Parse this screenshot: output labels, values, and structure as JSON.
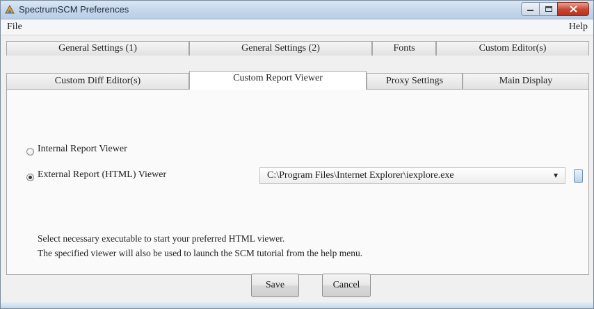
{
  "window": {
    "title": "SpectrumSCM Preferences",
    "icon": "spectrum-app-icon",
    "controls": [
      "minimize-icon",
      "maximize-icon",
      "close-icon"
    ]
  },
  "menu": {
    "file": "File",
    "help": "Help"
  },
  "tabs": {
    "row_back": [
      {
        "label": "General Settings (1)"
      },
      {
        "label": "General Settings (2)"
      },
      {
        "label": "Fonts"
      },
      {
        "label": "Custom Editor(s)"
      }
    ],
    "row_front": [
      {
        "label": "Custom Diff Editor(s)"
      },
      {
        "label": "Custom Report Viewer"
      },
      {
        "label": "Proxy Settings"
      },
      {
        "label": "Main Display"
      }
    ],
    "active": "Custom Report Viewer"
  },
  "options": {
    "internal_label": "Internal Report Viewer",
    "external_label": "External Report (HTML) Viewer",
    "selected": "external"
  },
  "viewer_path": {
    "value": "C:\\Program Files\\Internet Explorer\\iexplore.exe"
  },
  "info": {
    "line1": "Select necessary executable to start your preferred HTML viewer.",
    "line2": "The specified viewer will also be used to launch the SCM tutorial from the help menu."
  },
  "buttons": {
    "save": "Save",
    "cancel": "Cancel"
  },
  "colors": {
    "title_bar": "#c6d8ec",
    "close_button": "#c7452f",
    "panel": "#fafafa",
    "active_tab": "#ffffff"
  }
}
